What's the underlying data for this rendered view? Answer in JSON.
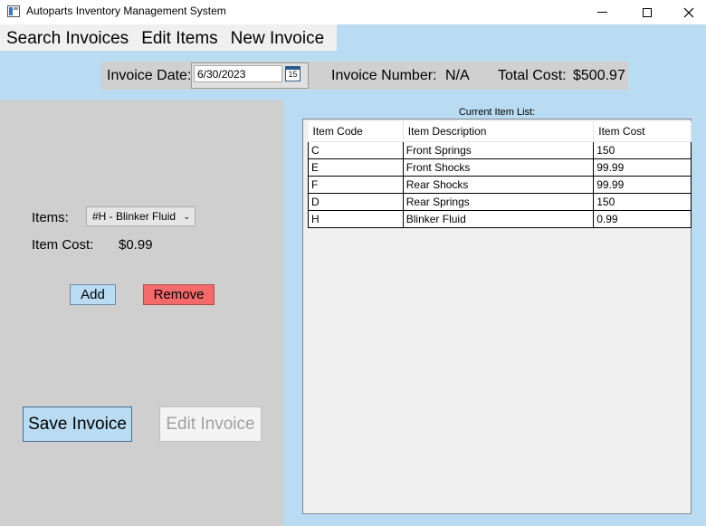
{
  "window": {
    "title": "Autoparts Inventory Management System"
  },
  "menu": {
    "items": [
      "Search Invoices",
      "Edit Items",
      "New Invoice"
    ]
  },
  "invoice": {
    "date_label": "Invoice Date:",
    "date_value": "6/30/2023",
    "calendar_icon_text": "15",
    "number_label": "Invoice Number:",
    "number_value": "N/A",
    "total_label": "Total Cost:",
    "total_value": "$500.97"
  },
  "editor": {
    "items_label": "Items:",
    "selected_item": "#H - Blinker Fluid",
    "item_cost_label": "Item Cost:",
    "item_cost_value": "$0.99",
    "add_label": "Add",
    "remove_label": "Remove",
    "save_label": "Save Invoice",
    "edit_label": "Edit Invoice"
  },
  "item_list": {
    "caption": "Current Item List:",
    "columns": [
      "Item Code",
      "Item Description",
      "Item Cost"
    ],
    "rows": [
      [
        "C",
        "Front Springs",
        "150"
      ],
      [
        "E",
        "Front Shocks",
        "99.99"
      ],
      [
        "F",
        "Rear Shocks",
        "99.99"
      ],
      [
        "D",
        "Rear Springs",
        "150"
      ],
      [
        "H",
        "Blinker Fluid",
        "0.99"
      ]
    ]
  },
  "colors": {
    "background": "#b9dcf2",
    "panel": "#d0cfcf",
    "remove_button": "#f46a6a",
    "primary_button": "#b9dcf2"
  }
}
